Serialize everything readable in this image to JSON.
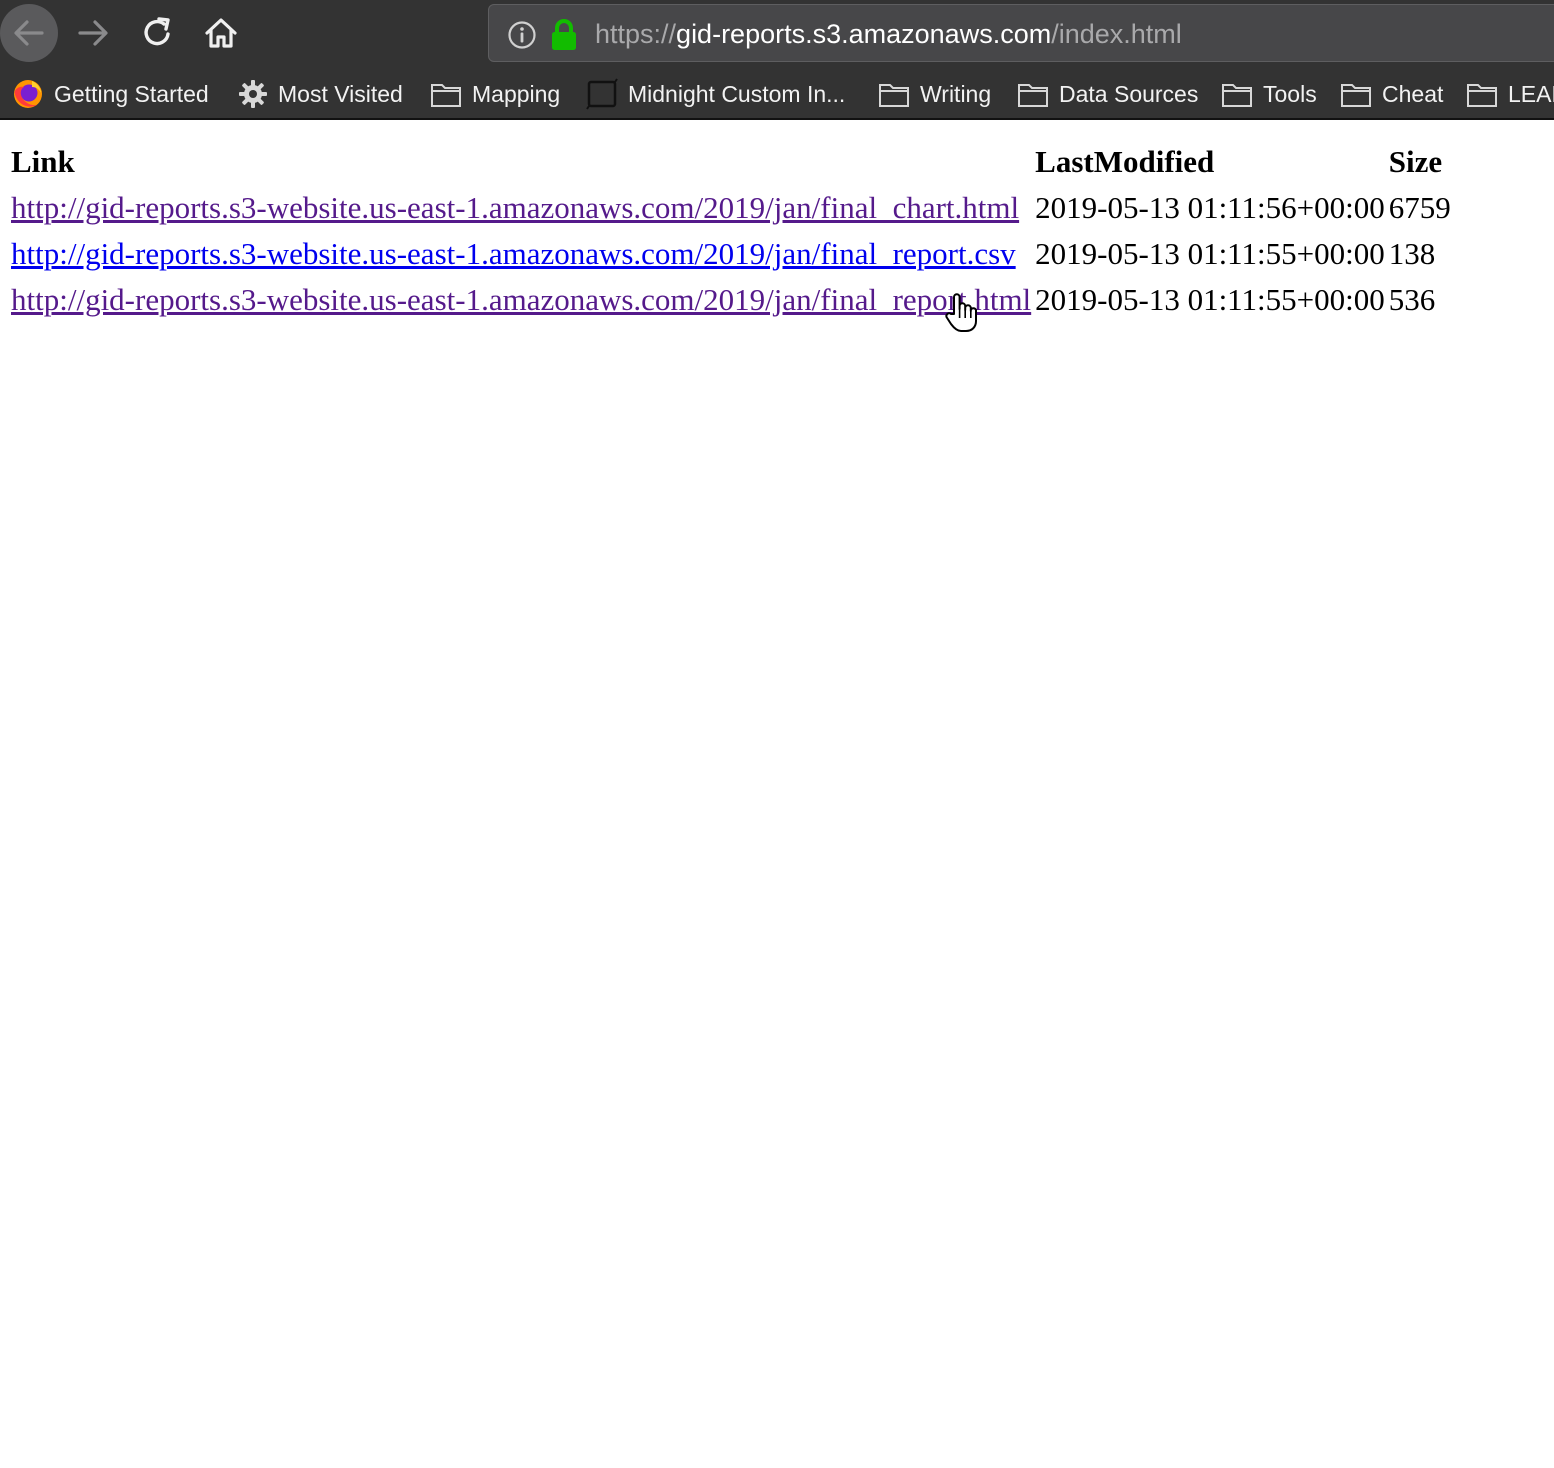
{
  "browser": {
    "url": {
      "scheme": "https://",
      "domain": "gid-reports.s3.amazonaws.com",
      "path": "/index.html"
    },
    "bookmarks": [
      {
        "label": "Getting Started",
        "icon": "firefox-icon"
      },
      {
        "label": "Most Visited",
        "icon": "gear-icon"
      },
      {
        "label": "Mapping",
        "icon": "folder-icon"
      },
      {
        "label": "Midnight Custom In...",
        "icon": "bookmark-page-icon"
      },
      {
        "label": "Writing",
        "icon": "folder-icon"
      },
      {
        "label": "Data Sources",
        "icon": "folder-icon"
      },
      {
        "label": "Tools",
        "icon": "folder-icon"
      },
      {
        "label": "Cheat",
        "icon": "folder-icon"
      },
      {
        "label": "LEAR",
        "icon": "folder-icon"
      }
    ],
    "colors": {
      "chrome": "#333333",
      "lock": "#12bc00",
      "visited_link": "#551a8b",
      "link": "#0000ee"
    }
  },
  "table": {
    "headers": [
      "Link",
      "LastModified",
      "Size"
    ],
    "rows": [
      {
        "link": "http://gid-reports.s3-website.us-east-1.amazonaws.com/2019/jan/final_chart.html",
        "last_modified": "2019-05-13 01:11:56+00:00",
        "size": "6759",
        "visited": true
      },
      {
        "link": "http://gid-reports.s3-website.us-east-1.amazonaws.com/2019/jan/final_report.csv",
        "last_modified": "2019-05-13 01:11:55+00:00",
        "size": "138",
        "visited": false
      },
      {
        "link": "http://gid-reports.s3-website.us-east-1.amazonaws.com/2019/jan/final_report.html",
        "last_modified": "2019-05-13 01:11:55+00:00",
        "size": "536",
        "visited": true
      }
    ]
  }
}
